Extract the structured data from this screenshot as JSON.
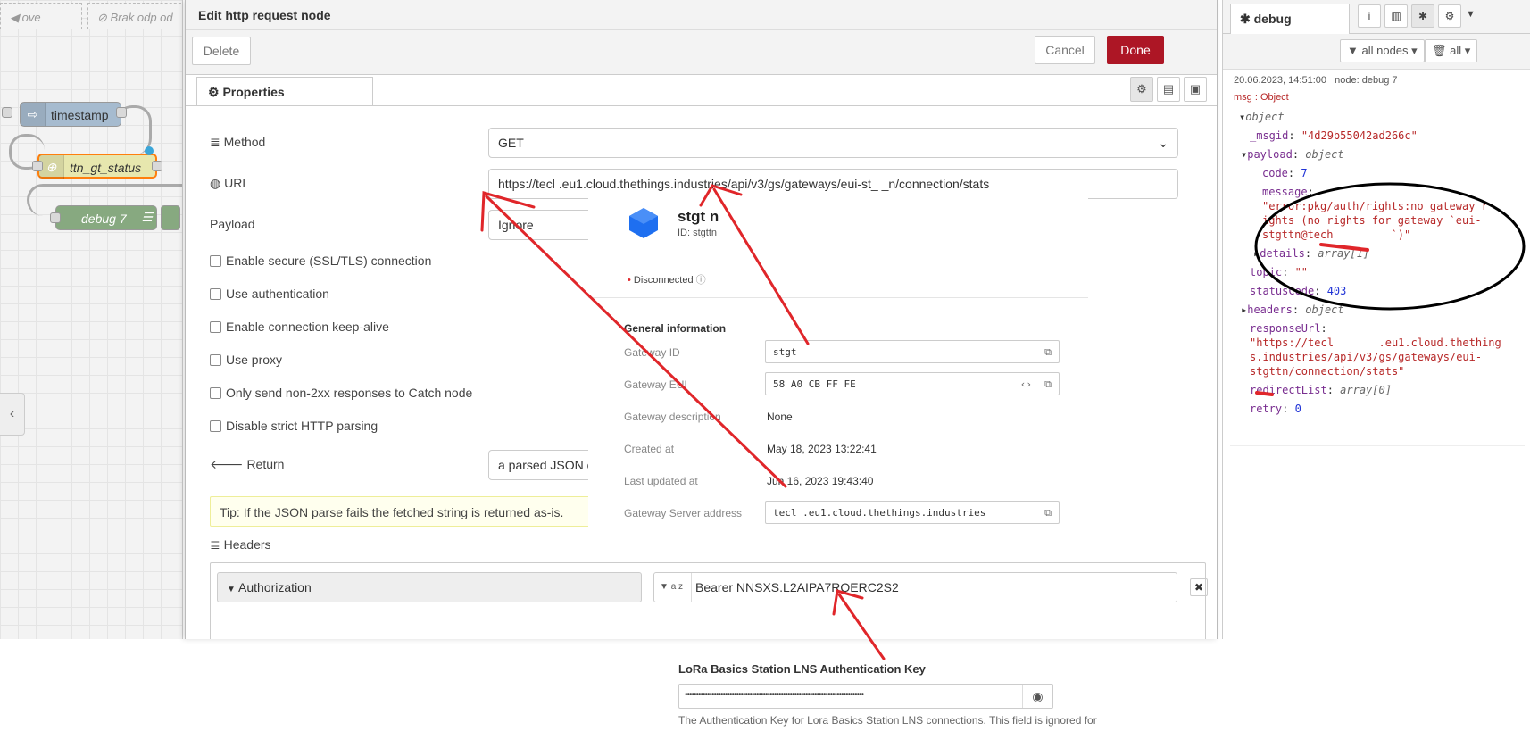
{
  "workspace": {
    "tabs": [
      "ove",
      "Brak odp od"
    ],
    "nodes": [
      "timestamp",
      "ttn_gt_status",
      "debug 7"
    ],
    "collapse_icon": "chevron-left-icon"
  },
  "tray": {
    "title": "Edit http request node",
    "delete_label": "Delete",
    "cancel_label": "Cancel",
    "done_label": "Done",
    "properties_tab": "Properties",
    "method_label": "Method",
    "method_value": "GET",
    "url_label": "URL",
    "url_value": "https://tecl         .eu1.cloud.thethings.industries/api/v3/gs/gateways/eui-st_ _n/connection/stats",
    "payload_label": "Payload",
    "payload_value": "Ignore",
    "checkboxes": [
      "Enable secure (SSL/TLS) connection",
      "Use authentication",
      "Enable connection keep-alive",
      "Use proxy",
      "Only send non-2xx responses to Catch node",
      "Disable strict HTTP parsing"
    ],
    "return_label": "Return",
    "return_value": "a parsed JSON object",
    "tip": "Tip: If the JSON parse fails the fetched string is returned as-is.",
    "headers_label": "Headers",
    "header_key": "Authorization",
    "header_type": "a z",
    "header_value": "Bearer NNSXS.L2AIPA7RQERC2S2"
  },
  "ttn": {
    "name": "stgt  n",
    "id_line": "ID: stgttn",
    "status": "Disconnected",
    "section": "General information",
    "rows": [
      {
        "label": "Gateway ID",
        "value": "stgt"
      },
      {
        "label": "Gateway EUI",
        "value": "58 A0 CB FF FE"
      },
      {
        "label": "Gateway description",
        "value": "None"
      },
      {
        "label": "Created at",
        "value": "May 18, 2023 13:22:41"
      },
      {
        "label": "Last updated at",
        "value": "Jun 16, 2023 19:43:40"
      },
      {
        "label": "Gateway Server address",
        "value": "tecl       .eu1.cloud.thethings.industries"
      }
    ],
    "lns_label": "LoRa Basics Station LNS Authentication Key",
    "lns_help": "The Authentication Key for Lora Basics Station LNS connections. This field is ignored for"
  },
  "debug": {
    "tab_label": "debug",
    "filter_nodes": "all nodes",
    "filter_all": "all",
    "timestamp": "20.06.2023, 14:51:00",
    "node": "node: debug 7",
    "msg_type": "msg : Object",
    "object_label": "object",
    "msgid_key": "_msgid",
    "msgid_val": "\"4d29b55042ad266c\"",
    "payload_key": "payload",
    "payload_type": "object",
    "code_key": "code",
    "code_val": "7",
    "message_key": "message",
    "message_val_1": "\"error:pkg/auth/rights:no_gateway_r",
    "message_val_2": "ights (no rights for gateway `eui-",
    "message_val_3": "stgttn@tech         `)\"",
    "details_key": "details",
    "details_type": "array[1]",
    "topic_key": "topic",
    "topic_val": "\"\"",
    "status_key": "statusCode",
    "status_val": "403",
    "headers_key": "headers",
    "headers_type": "object",
    "resp_key": "responseUrl",
    "resp_1": "\"https://tecl       .eu1.cloud.thething",
    "resp_2": "s.industries/api/v3/gs/gateways/eui-",
    "resp_3": "stgttn/connection/stats\"",
    "redirect_key": "redirectList",
    "redirect_type": "array[0]",
    "retry_key": "retry",
    "retry_val": "0"
  },
  "colors": {
    "primary": "#ad1625",
    "annotation": "#e0262a",
    "ttn_blue": "#1e6ff0"
  }
}
